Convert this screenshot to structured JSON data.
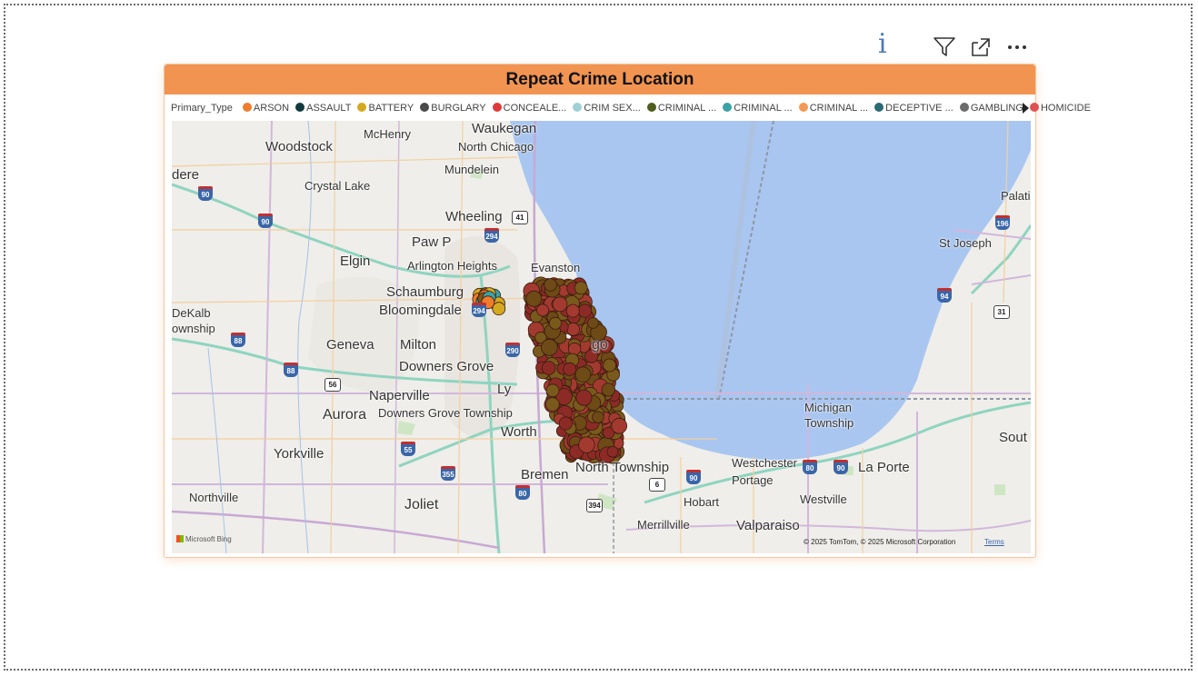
{
  "visual": {
    "title": "Repeat Crime Location"
  },
  "legend": {
    "title": "Primary_Type",
    "items": [
      {
        "label": "ARSON",
        "color": "#f07c2b"
      },
      {
        "label": "ASSAULT",
        "color": "#0f3b3f"
      },
      {
        "label": "BATTERY",
        "color": "#d4a91f"
      },
      {
        "label": "BURGLARY",
        "color": "#4a4a4a"
      },
      {
        "label": "CONCEALE...",
        "color": "#e03a3a"
      },
      {
        "label": "CRIM SEX...",
        "color": "#9fd0d6"
      },
      {
        "label": "CRIMINAL ...",
        "color": "#4e5e1c"
      },
      {
        "label": "CRIMINAL ...",
        "color": "#3aa3a8"
      },
      {
        "label": "CRIMINAL ...",
        "color": "#f29a55"
      },
      {
        "label": "DECEPTIVE ...",
        "color": "#2a6a74"
      },
      {
        "label": "GAMBLING",
        "color": "#6b6b6b"
      },
      {
        "label": "HOMICIDE",
        "color": "#e05252"
      }
    ]
  },
  "toolbar": {
    "info_glyph": "i",
    "icons": [
      "filter-icon",
      "focus-mode-icon",
      "more-options-icon"
    ]
  },
  "map": {
    "attribution": "© 2025 TomTom, © 2025 Microsoft Corporation",
    "terms_label": "Terms",
    "provider_label": "Microsoft Bing",
    "water_color": "#a9c6f0",
    "marker_colors": [
      "#8c2b26",
      "#7a5a1c",
      "#a33a30",
      "#6d4a16"
    ],
    "places": [
      {
        "name": "Waukegan"
      },
      {
        "name": "McHenry"
      },
      {
        "name": "North Chicago"
      },
      {
        "name": "Woodstock"
      },
      {
        "name": "Mundelein"
      },
      {
        "name": "dere"
      },
      {
        "name": "Crystal Lake"
      },
      {
        "name": "Wheeling"
      },
      {
        "name": "Palatine"
      },
      {
        "name": "Paw P"
      },
      {
        "name": "St Joseph"
      },
      {
        "name": "Elgin"
      },
      {
        "name": "Arlington Heights"
      },
      {
        "name": "Evanston"
      },
      {
        "name": "Schaumburg"
      },
      {
        "name": "Bloomingdale"
      },
      {
        "name": "DeKalb"
      },
      {
        "name": "ownship"
      },
      {
        "name": "Geneva"
      },
      {
        "name": "Milton"
      },
      {
        "name": "go"
      },
      {
        "name": "Downers Grove"
      },
      {
        "name": "Naperville"
      },
      {
        "name": "Ly"
      },
      {
        "name": "Aurora"
      },
      {
        "name": "Downers Grove Township"
      },
      {
        "name": "Michigan"
      },
      {
        "name": "Township"
      },
      {
        "name": "Worth"
      },
      {
        "name": "Sout"
      },
      {
        "name": "Yorkville"
      },
      {
        "name": "Bremen"
      },
      {
        "name": "North Township"
      },
      {
        "name": "Westchester"
      },
      {
        "name": "Portage"
      },
      {
        "name": "La Porte"
      },
      {
        "name": "Northville"
      },
      {
        "name": "Joliet"
      },
      {
        "name": "Hobart"
      },
      {
        "name": "Westville"
      },
      {
        "name": "Merrillville"
      },
      {
        "name": "Valparaiso"
      }
    ],
    "shields": [
      "90",
      "90",
      "41",
      "294",
      "294",
      "88",
      "88",
      "56",
      "290",
      "55",
      "355",
      "80",
      "394",
      "6",
      "90",
      "80",
      "90",
      "94",
      "196",
      "31"
    ]
  }
}
